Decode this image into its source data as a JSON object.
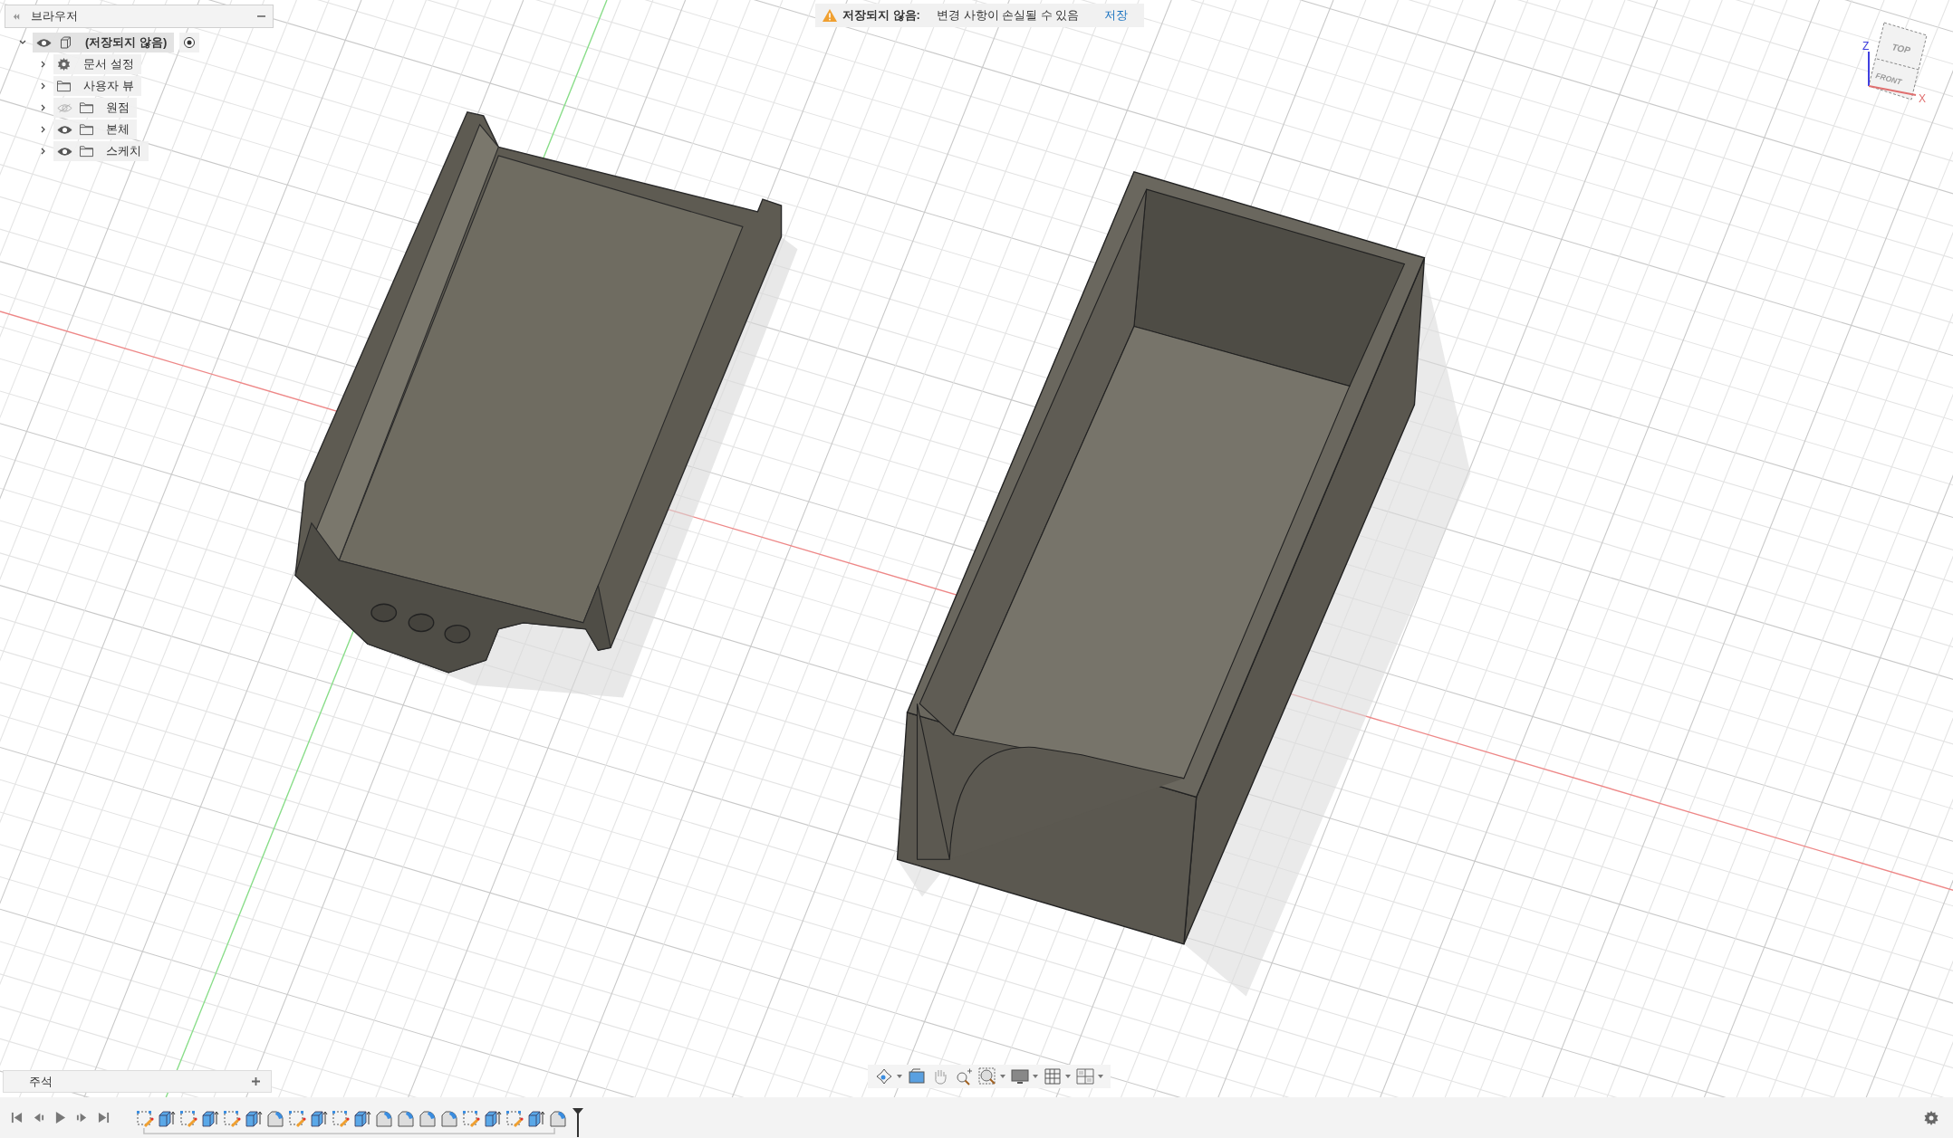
{
  "browser": {
    "title": "브라우저",
    "root": {
      "label": "(저장되지 않음)",
      "expanded": true,
      "visible": true,
      "children": [
        {
          "label": "문서 설정",
          "kind": "settings",
          "expanded": false
        },
        {
          "label": "사용자 뷰",
          "kind": "folder",
          "expanded": false
        },
        {
          "label": "원점",
          "kind": "folder",
          "expanded": false,
          "visible": false
        },
        {
          "label": "본체",
          "kind": "folder",
          "expanded": false,
          "visible": true
        },
        {
          "label": "스케치",
          "kind": "folder",
          "expanded": false,
          "visible": true
        }
      ]
    }
  },
  "notice": {
    "title": "저장되지 않음:",
    "message": "변경 사항이 손실될 수 있음",
    "action": "저장"
  },
  "view_cube": {
    "top": "TOP",
    "front": "FRONT",
    "z_axis": "Z",
    "x_axis": "X"
  },
  "comments_panel": {
    "title": "주석"
  },
  "timeline": {
    "features": [
      {
        "kind": "sketch"
      },
      {
        "kind": "extrude"
      },
      {
        "kind": "sketch"
      },
      {
        "kind": "extrude"
      },
      {
        "kind": "sketch"
      },
      {
        "kind": "extrude"
      },
      {
        "kind": "fillet"
      },
      {
        "kind": "sketch"
      },
      {
        "kind": "extrude"
      },
      {
        "kind": "sketch"
      },
      {
        "kind": "extrude"
      },
      {
        "kind": "fillet"
      },
      {
        "kind": "fillet"
      },
      {
        "kind": "fillet"
      },
      {
        "kind": "fillet"
      },
      {
        "kind": "sketch"
      },
      {
        "kind": "extrude"
      },
      {
        "kind": "sketch"
      },
      {
        "kind": "extrude"
      },
      {
        "kind": "fillet"
      }
    ]
  }
}
